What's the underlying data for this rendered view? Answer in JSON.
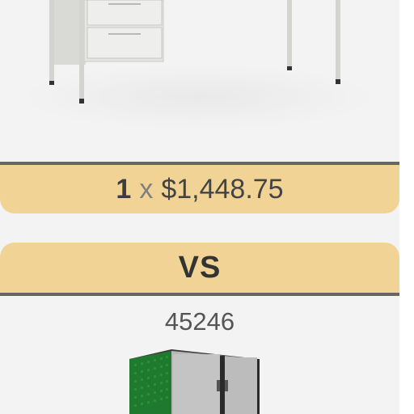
{
  "first_item": {
    "quantity": "1",
    "times": "x",
    "price": "$1,448.75",
    "image_icon": "desk-icon"
  },
  "comparison": {
    "label": "VS"
  },
  "second_item": {
    "id": "45246",
    "image_icon": "storage-cabinet-icon"
  },
  "colors": {
    "accent_bar": "#f1d495",
    "bar_border": "#666666",
    "background": "#f3f3f3"
  }
}
